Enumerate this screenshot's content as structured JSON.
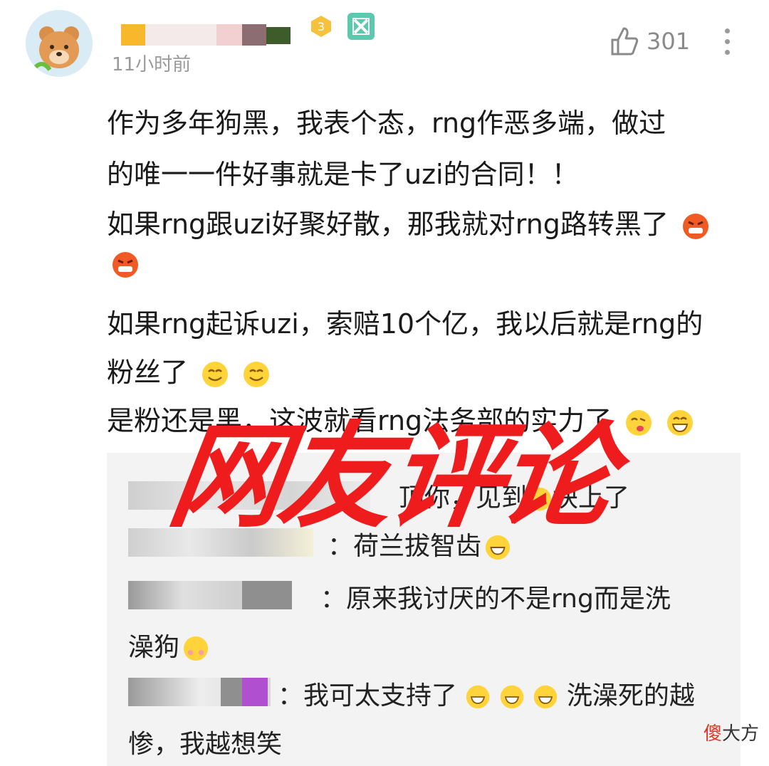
{
  "post": {
    "time": "11小时前",
    "like_count": "301",
    "lines": [
      "作为多年狗黑，我表个态，rng作恶多端，做过",
      "的唯一一件好事就是卡了uzi的合同！！",
      "如果rng跟uzi好聚好散，那我就对rng路转黑了",
      "",
      "如果rng起诉uzi，索赔10个亿，我以后就是rng的",
      "粉丝了",
      "是粉还是黑，这波就看rng法务部的实力了"
    ]
  },
  "replies": [
    {
      "text": "顶你，见到",
      "text2": "块上了"
    },
    {
      "text": "：荷兰拔智齿"
    },
    {
      "text": "：原来我讨厌的不是rng而是洗",
      "cont": "澡狗"
    },
    {
      "text": "：我可太支持了",
      "text2": "洗澡死的越",
      "cont": "惨，我越想笑"
    }
  ],
  "overlay_text": "网友评论",
  "watermark": {
    "a": "傻",
    "b": "大方"
  },
  "icons": {
    "level_badge": "level-3-badge",
    "vip": "vip-icon",
    "like": "thumbs-up-icon",
    "more": "more-vertical-icon",
    "emoji_angry": "angry-emoji-icon",
    "emoji_smile": "smile-emoji-icon",
    "emoji_tongue": "tongue-emoji-icon",
    "emoji_grin": "grin-emoji-icon"
  },
  "colors": {
    "accent": "#ee1c1c",
    "time": "#9a9a9a",
    "reply_bg": "#f3f3f3"
  }
}
